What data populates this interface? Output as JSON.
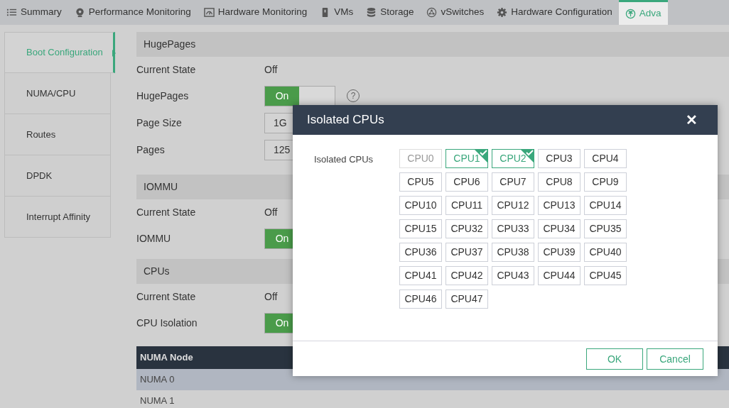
{
  "tabs": [
    {
      "label": "Summary",
      "selected": false
    },
    {
      "label": "Performance Monitoring",
      "selected": false
    },
    {
      "label": "Hardware Monitoring",
      "selected": false
    },
    {
      "label": "VMs",
      "selected": false
    },
    {
      "label": "Storage",
      "selected": false
    },
    {
      "label": "vSwitches",
      "selected": false
    },
    {
      "label": "Hardware Configuration",
      "selected": false
    },
    {
      "label": "Adva",
      "selected": true
    }
  ],
  "sidebar": {
    "items": [
      {
        "label": "Boot Configuration",
        "selected": true
      },
      {
        "label": "NUMA/CPU",
        "selected": false
      },
      {
        "label": "Routes",
        "selected": false
      },
      {
        "label": "DPDK",
        "selected": false
      },
      {
        "label": "Interrupt Affinity",
        "selected": false
      }
    ]
  },
  "sections": [
    {
      "title": "HugePages",
      "rows": [
        {
          "kind": "text",
          "label": "Current State",
          "value": "Off"
        },
        {
          "kind": "toggle",
          "label": "HugePages",
          "value": "On",
          "on": true,
          "help": "?"
        },
        {
          "kind": "input",
          "label": "Page Size",
          "value": "1G"
        },
        {
          "kind": "input",
          "label": "Pages",
          "value": "125"
        }
      ]
    },
    {
      "title": "IOMMU",
      "rows": [
        {
          "kind": "text",
          "label": "Current State",
          "value": "Off"
        },
        {
          "kind": "toggle",
          "label": "IOMMU",
          "value": "On",
          "on": true
        }
      ]
    },
    {
      "title": "CPUs",
      "rows": [
        {
          "kind": "text",
          "label": "Current State",
          "value": "Off"
        },
        {
          "kind": "toggle",
          "label": "CPU Isolation",
          "value": "On",
          "on": true
        }
      ]
    }
  ],
  "table": {
    "columns": [
      "NUMA Node"
    ],
    "rows": [
      {
        "cells": [
          "NUMA 0"
        ],
        "selected": true
      },
      {
        "cells": [
          "NUMA 1"
        ],
        "selected": false
      }
    ]
  },
  "dialog": {
    "title": "Isolated CPUs",
    "close": "✕",
    "field_label": "Isolated CPUs",
    "cpus": [
      {
        "label": "CPU0",
        "selected": false,
        "disabled": true
      },
      {
        "label": "CPU1",
        "selected": true,
        "disabled": false
      },
      {
        "label": "CPU2",
        "selected": true,
        "disabled": false
      },
      {
        "label": "CPU3",
        "selected": false,
        "disabled": false
      },
      {
        "label": "CPU4",
        "selected": false,
        "disabled": false
      },
      {
        "label": "CPU5",
        "selected": false,
        "disabled": false
      },
      {
        "label": "CPU6",
        "selected": false,
        "disabled": false
      },
      {
        "label": "CPU7",
        "selected": false,
        "disabled": false
      },
      {
        "label": "CPU8",
        "selected": false,
        "disabled": false
      },
      {
        "label": "CPU9",
        "selected": false,
        "disabled": false
      },
      {
        "label": "CPU10",
        "selected": false,
        "disabled": false
      },
      {
        "label": "CPU11",
        "selected": false,
        "disabled": false
      },
      {
        "label": "CPU12",
        "selected": false,
        "disabled": false
      },
      {
        "label": "CPU13",
        "selected": false,
        "disabled": false
      },
      {
        "label": "CPU14",
        "selected": false,
        "disabled": false
      },
      {
        "label": "CPU15",
        "selected": false,
        "disabled": false
      },
      {
        "label": "CPU32",
        "selected": false,
        "disabled": false
      },
      {
        "label": "CPU33",
        "selected": false,
        "disabled": false
      },
      {
        "label": "CPU34",
        "selected": false,
        "disabled": false
      },
      {
        "label": "CPU35",
        "selected": false,
        "disabled": false
      },
      {
        "label": "CPU36",
        "selected": false,
        "disabled": false
      },
      {
        "label": "CPU37",
        "selected": false,
        "disabled": false
      },
      {
        "label": "CPU38",
        "selected": false,
        "disabled": false
      },
      {
        "label": "CPU39",
        "selected": false,
        "disabled": false
      },
      {
        "label": "CPU40",
        "selected": false,
        "disabled": false
      },
      {
        "label": "CPU41",
        "selected": false,
        "disabled": false
      },
      {
        "label": "CPU42",
        "selected": false,
        "disabled": false
      },
      {
        "label": "CPU43",
        "selected": false,
        "disabled": false
      },
      {
        "label": "CPU44",
        "selected": false,
        "disabled": false
      },
      {
        "label": "CPU45",
        "selected": false,
        "disabled": false
      },
      {
        "label": "CPU46",
        "selected": false,
        "disabled": false
      },
      {
        "label": "CPU47",
        "selected": false,
        "disabled": false
      }
    ],
    "buttons": [
      {
        "label": "OK"
      },
      {
        "label": "Cancel"
      }
    ]
  }
}
